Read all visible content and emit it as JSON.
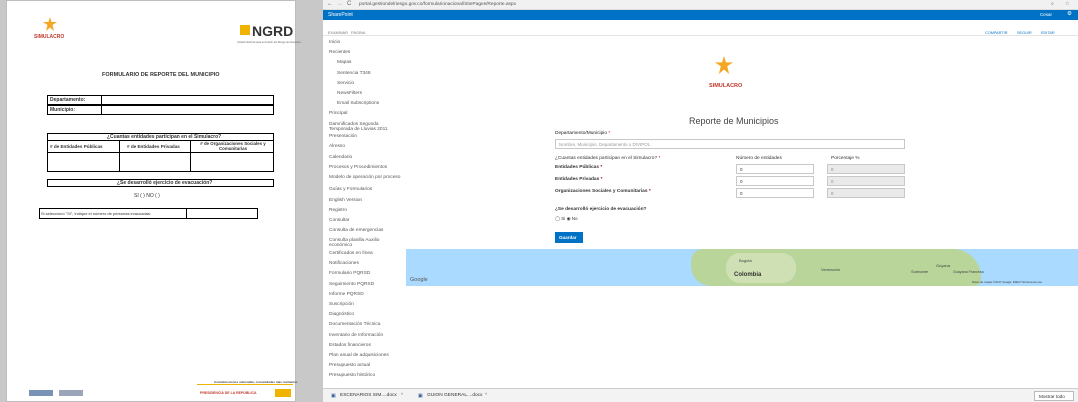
{
  "doc": {
    "simulacro_logo_text": "SIMULACRO",
    "ngrd_logo_text": "NGRD",
    "ngrd_sub": "Unidad Nacional para la Gestión del Riesgo de Desastres",
    "title": "FORMULARIO DE REPORTE DEL MUNICIPIO",
    "dept_label": "Departamento:",
    "muni_label": "Municipio:",
    "q1": "¿Cuantas entidades participan en el Simulacro?",
    "col1": "# de Entidades Públicas",
    "col2": "# de Entidades Privadas",
    "col3": "# de Organizaciones Sociales y Comunitarias",
    "q2": "¿Se desarrolló ejercicio de evacuación?",
    "si_no": "SI (  )     NO (  )",
    "q3": "Si seleccionó \"SI\", indique el número de personas evacuadas:",
    "footer_slogan": "Colombia menos vulnerable, comunidades más resilientes",
    "footer_presidencia": "PRESIDENCIA DE LA REPÚBLICA"
  },
  "browser": {
    "url": "portal.gestiondelriesgo.gov.co/formularionacional/SitePages/Reporte.aspx",
    "app": "SharePoint",
    "topright": "Cesar",
    "ribbon_tabs": [
      "EXAMINAR",
      "PÁGINA"
    ],
    "ribbon_actions": [
      "COMPARTIR",
      "SEGUIR",
      "EDITAR"
    ],
    "nav": [
      "Inicio",
      "Recientes",
      "Mapas",
      "Sentencia T348",
      "Servicio",
      "NewsFilters",
      "Email Subscriptions",
      "Principal",
      "Damnificados Segunda Temporada de Lluvias 2011",
      "Presentación",
      "Alresso",
      "Calendario",
      "Procesos y Procedimientos",
      "Modelo de operación por proceso",
      "Guías y Formularios",
      "English Version",
      "Registro",
      "Consultar",
      "Consulta de emergencias",
      "Consulta planilla Auxilio económico",
      "Certificados en línea",
      "Notificaciones",
      "Formulario PQRSD",
      "Seguimiento PQRSD",
      "Informe PQRSD",
      "Suscripción",
      "Diagnóstico",
      "Documentación Técnica",
      "Inventario de Información",
      "Estados financieros",
      "Plan anual de adquisiciones",
      "Presupuesto actual",
      "Presupuesto histórico"
    ],
    "form": {
      "logo_text": "SIMULACRO",
      "title": "Reporte de Municipios",
      "dept_label": "Departamento/Municipio",
      "dept_placeholder": "Nombre, Municipio, Departamento o DIVIPOL",
      "q1": "¿Cuantas entidades participan en el Simulacro?",
      "col_num": "Número de entidades",
      "col_pct": "Porcentaje %",
      "row1": "Entidades Públicas",
      "row2": "Entidades Privadas",
      "row3": "Organizaciones Sociales y Comunitarias",
      "val1": "0",
      "val2": "0",
      "val3": "0",
      "pct1": "0",
      "pct2": "0",
      "pct3": "0",
      "q2": "¿Se desarrolló ejercicio de evacuación?",
      "radio_si": "Si",
      "radio_no": "No",
      "save": "Guardar"
    },
    "map": {
      "labels": [
        "Bogotá",
        "Colombia",
        "Guyana",
        "Suriname",
        "Guayana Francesa",
        "Venezuela"
      ],
      "google": "Google",
      "attribution": "Datos de mapas ©2017 Google, INEGI   Términos de uso"
    },
    "taskbar": {
      "item1": "ESCENARIOS SIM....docx",
      "item2": "GUION GENERAL....docx",
      "show_all": "Mostrar todo"
    }
  }
}
